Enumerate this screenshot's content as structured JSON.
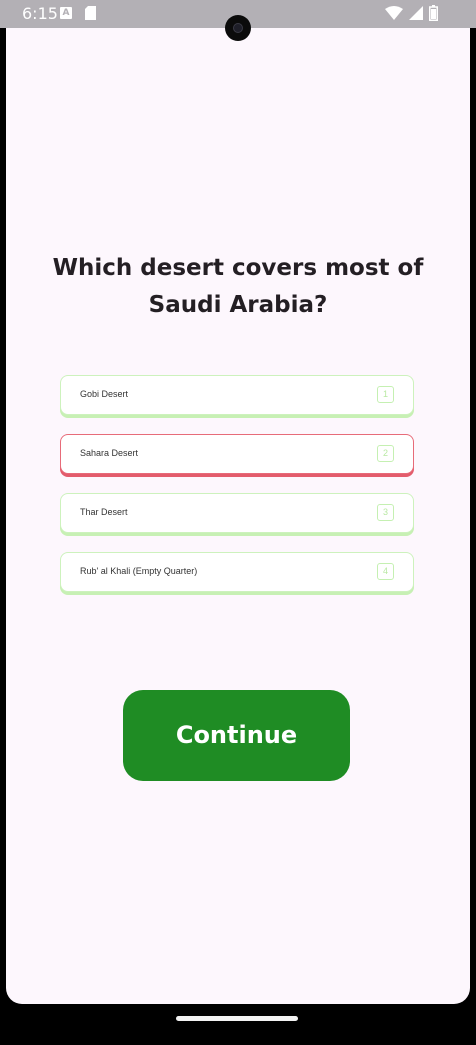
{
  "status_bar": {
    "time": "6:15",
    "notification_icon_letter": "A",
    "icons": [
      "a-notification-icon",
      "sim-card-icon",
      "wifi-icon",
      "cellular-signal-icon",
      "battery-icon"
    ]
  },
  "quiz": {
    "question": "Which desert covers most of Saudi Arabia?",
    "options": [
      {
        "label": "Gobi Desert",
        "key": "1",
        "selected": false
      },
      {
        "label": "Sahara Desert",
        "key": "2",
        "selected": true
      },
      {
        "label": "Thar Desert",
        "key": "3",
        "selected": false
      },
      {
        "label": "Rub' al Khali (Empty Quarter)",
        "key": "4",
        "selected": false
      }
    ],
    "continue_label": "Continue"
  },
  "colors": {
    "background": "#fdf7fd",
    "option_border": "#cdf2bd",
    "selected_border": "#e76b79",
    "continue_button": "#1f8c24",
    "status_bar": "#b3b0b5"
  }
}
